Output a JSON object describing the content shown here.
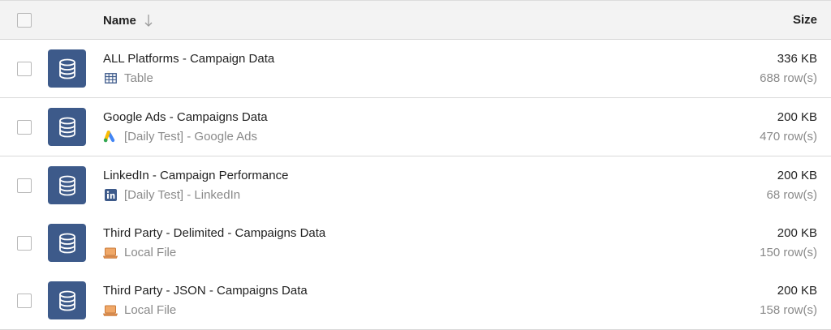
{
  "header": {
    "name_label": "Name",
    "size_label": "Size"
  },
  "rows": [
    {
      "title": "ALL Platforms - Campaign Data",
      "source": "Table",
      "source_icon": "table-icon",
      "size": "336 KB",
      "rows": "688 row(s)"
    },
    {
      "title": "Google Ads - Campaigns Data",
      "source": "[Daily Test] - Google Ads",
      "source_icon": "google-ads-icon",
      "size": "200 KB",
      "rows": "470 row(s)"
    },
    {
      "title": "LinkedIn - Campaign Performance",
      "source": "[Daily Test] - LinkedIn",
      "source_icon": "linkedin-icon",
      "size": "200 KB",
      "rows": "68 row(s)"
    },
    {
      "title": "Third Party - Delimited - Campaigns Data",
      "source": "Local File",
      "source_icon": "laptop-icon",
      "size": "200 KB",
      "rows": "150 row(s)"
    },
    {
      "title": "Third Party - JSON - Campaigns Data",
      "source": "Local File",
      "source_icon": "laptop-icon",
      "size": "200 KB",
      "rows": "158 row(s)"
    }
  ],
  "colors": {
    "db_icon_bg": "#3d5a8a",
    "header_bg": "#f3f3f3",
    "muted_text": "#8a8a8a"
  }
}
